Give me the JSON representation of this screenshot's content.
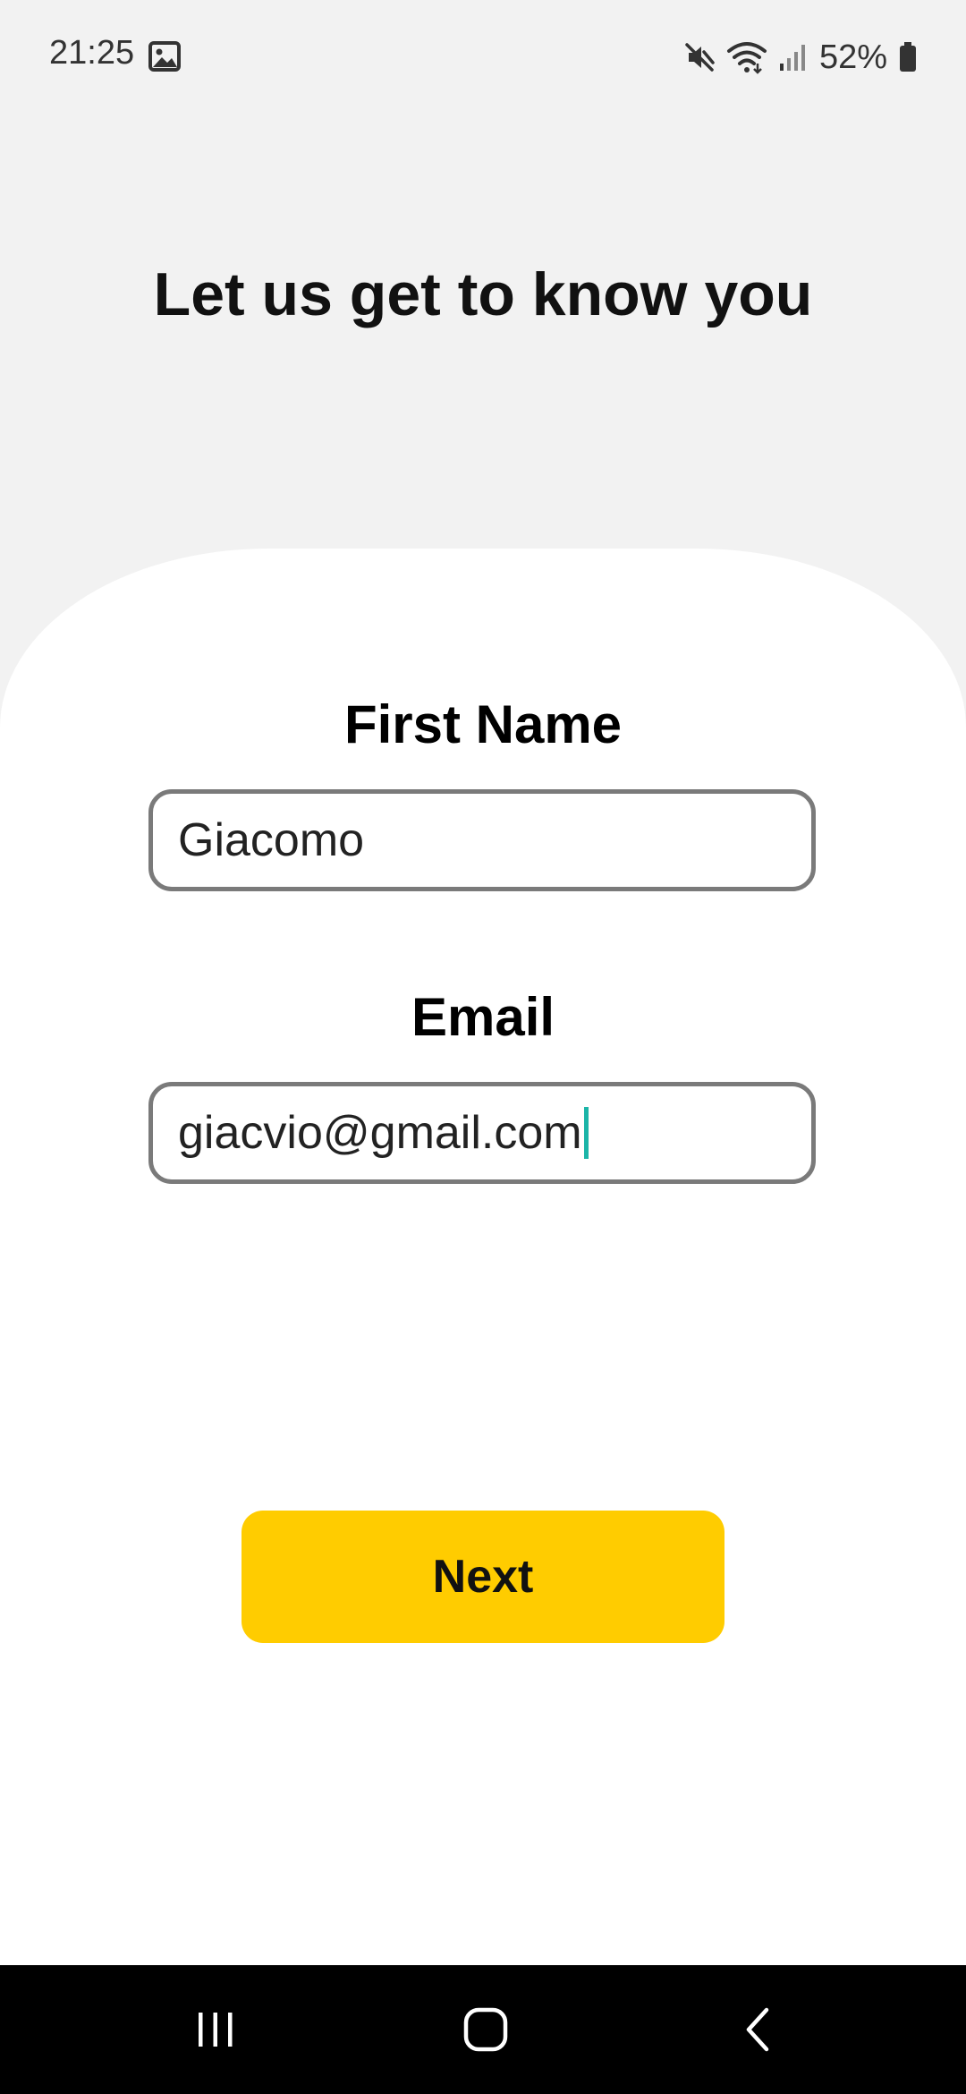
{
  "status_bar": {
    "time": "21:25",
    "battery": "52%",
    "icons": [
      "image-icon",
      "mute-icon",
      "wifi-icon",
      "signal-icon",
      "battery-icon"
    ]
  },
  "page": {
    "title": "Let us get to know you"
  },
  "form": {
    "first_name_label": "First Name",
    "first_name_value": "Giacomo",
    "email_label": "Email",
    "email_value": "giacvio@gmail.com",
    "next_label": "Next"
  },
  "colors": {
    "background": "#f2f2f2",
    "sheet": "#ffffff",
    "accent": "#ffcc00",
    "input_border": "#7a7a7a",
    "caret": "#1bb5a8"
  },
  "nav_bar": {
    "icons": [
      "recents-icon",
      "home-icon",
      "back-icon"
    ]
  }
}
